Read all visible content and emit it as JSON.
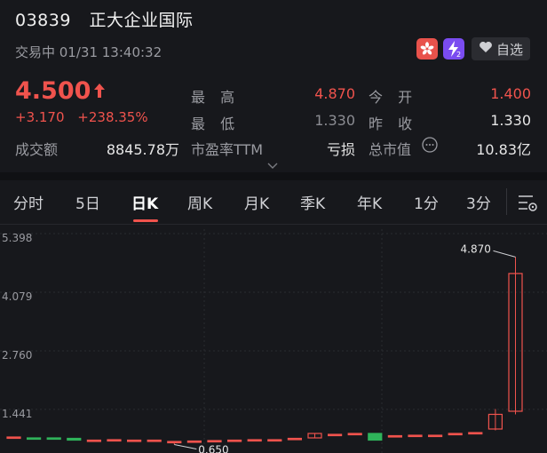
{
  "header": {
    "code": "03839",
    "name": "正大企业国际",
    "status": "交易中 01/31 13:40:32",
    "fav_label": "自选"
  },
  "quote": {
    "price": "4.500",
    "change": "+3.170",
    "change_pct": "+238.35%",
    "high_label": "最 高",
    "high": "4.870",
    "open_label": "今 开",
    "open": "1.400",
    "low_label": "最 低",
    "low": "1.330",
    "prev_close_label": "昨 收",
    "prev_close": "1.330",
    "turnover_label": "成交额",
    "turnover": "8845.78万",
    "pe_label": "市盈率TTM",
    "pe": "亏损",
    "mcap_label": "总市值",
    "mcap": "10.83亿"
  },
  "tabs": [
    "分时",
    "5日",
    "日K",
    "周K",
    "月K",
    "季K",
    "年K",
    "1分",
    "3分"
  ],
  "active_tab": "日K",
  "colors": {
    "up": "#f0534d",
    "down": "#2fb35a",
    "accent": "#f0534d"
  },
  "chart_data": {
    "type": "candlestick",
    "y_ticks": [
      "5.398",
      "4.079",
      "2.760",
      "1.441"
    ],
    "ylim": [
      0.6,
      5.398
    ],
    "max_label": "4.870",
    "min_label": "0.650",
    "candles": [
      {
        "o": 0.82,
        "c": 0.82,
        "h": 0.82,
        "l": 0.82
      },
      {
        "o": 0.8,
        "c": 0.79,
        "h": 0.8,
        "l": 0.79
      },
      {
        "o": 0.8,
        "c": 0.78,
        "h": 0.8,
        "l": 0.78
      },
      {
        "o": 0.79,
        "c": 0.75,
        "h": 0.79,
        "l": 0.75
      },
      {
        "o": 0.75,
        "c": 0.75,
        "h": 0.75,
        "l": 0.75
      },
      {
        "o": 0.76,
        "c": 0.76,
        "h": 0.76,
        "l": 0.76
      },
      {
        "o": 0.75,
        "c": 0.75,
        "h": 0.75,
        "l": 0.75
      },
      {
        "o": 0.75,
        "c": 0.75,
        "h": 0.76,
        "l": 0.72
      },
      {
        "o": 0.72,
        "c": 0.72,
        "h": 0.72,
        "l": 0.65
      },
      {
        "o": 0.73,
        "c": 0.73,
        "h": 0.73,
        "l": 0.73
      },
      {
        "o": 0.74,
        "c": 0.74,
        "h": 0.74,
        "l": 0.74
      },
      {
        "o": 0.75,
        "c": 0.75,
        "h": 0.75,
        "l": 0.75
      },
      {
        "o": 0.76,
        "c": 0.76,
        "h": 0.76,
        "l": 0.76
      },
      {
        "o": 0.76,
        "c": 0.76,
        "h": 0.76,
        "l": 0.76
      },
      {
        "o": 0.79,
        "c": 0.79,
        "h": 0.79,
        "l": 0.79
      },
      {
        "o": 0.8,
        "c": 0.9,
        "h": 0.9,
        "l": 0.8
      },
      {
        "o": 0.88,
        "c": 0.88,
        "h": 0.88,
        "l": 0.88
      },
      {
        "o": 0.9,
        "c": 0.9,
        "h": 0.9,
        "l": 0.9
      },
      {
        "o": 0.9,
        "c": 0.75,
        "h": 0.9,
        "l": 0.75
      },
      {
        "o": 0.85,
        "c": 0.85,
        "h": 0.85,
        "l": 0.85
      },
      {
        "o": 0.86,
        "c": 0.86,
        "h": 0.86,
        "l": 0.86
      },
      {
        "o": 0.86,
        "c": 0.86,
        "h": 0.86,
        "l": 0.86
      },
      {
        "o": 0.9,
        "c": 0.9,
        "h": 0.9,
        "l": 0.9
      },
      {
        "o": 0.9,
        "c": 0.92,
        "h": 0.92,
        "l": 0.88
      },
      {
        "o": 1.0,
        "c": 1.33,
        "h": 1.45,
        "l": 0.97
      },
      {
        "o": 1.4,
        "c": 4.5,
        "h": 4.87,
        "l": 1.33
      }
    ]
  }
}
